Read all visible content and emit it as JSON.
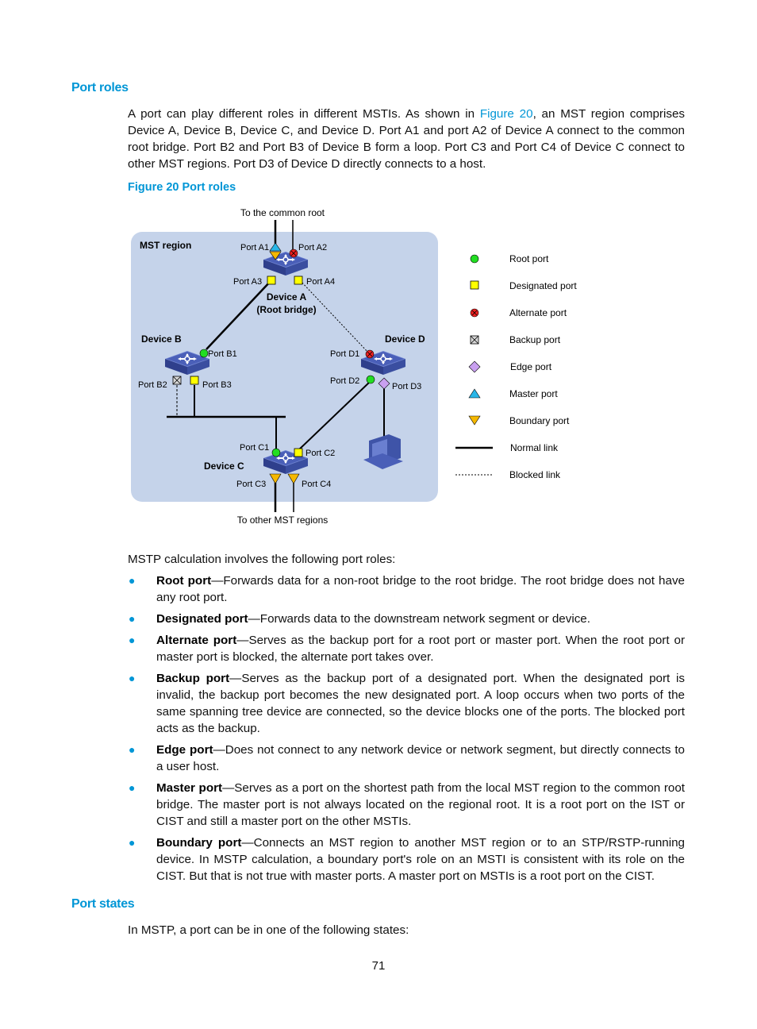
{
  "sections": {
    "port_roles": {
      "heading": "Port roles",
      "intro_before_link": "A port can play different roles in different MSTIs. As shown in ",
      "intro_link": "Figure 20",
      "intro_after_link": ", an MST region comprises Device A, Device B, Device C, and Device D. Port A1 and port A2 of Device A connect to the common root bridge. Port B2 and Port B3 of Device B form a loop. Port C3 and Port C4 of Device C connect to other MST regions. Port D3 of Device D directly connects to a host.",
      "figure_caption": "Figure 20 Port roles",
      "list_intro": "MSTP calculation involves the following port roles:",
      "roles": [
        {
          "term": "Root port",
          "desc": "—Forwards data for a non-root bridge to the root bridge. The root bridge does not have any root port."
        },
        {
          "term": "Designated port",
          "desc": "—Forwards data to the downstream network segment or device."
        },
        {
          "term": "Alternate port",
          "desc": "—Serves as the backup port for a root port or master port. When the root port or master port is blocked, the alternate port takes over."
        },
        {
          "term": "Backup port",
          "desc": "—Serves as the backup port of a designated port. When the designated port is invalid, the backup port becomes the new designated port. A loop occurs when two ports of the same spanning tree device are connected, so the device blocks one of the ports. The blocked port acts as the backup."
        },
        {
          "term": "Edge port",
          "desc": "—Does not connect to any network device or network segment, but directly connects to a user host."
        },
        {
          "term": "Master port",
          "desc": "—Serves as a port on the shortest path from the local MST region to the common root bridge. The master port is not always located on the regional root. It is a root port on the IST or CIST and still a master port on the other MSTIs."
        },
        {
          "term": "Boundary port",
          "desc": "—Connects an MST region to another MST region or to an STP/RSTP-running device. In MSTP calculation, a boundary port's role on an MSTI is consistent with its role on the CIST. But that is not true with master ports. A master port on MSTIs is a root port on the CIST."
        }
      ]
    },
    "port_states": {
      "heading": "Port states",
      "intro": "In MSTP, a port can be in one of the following states:"
    }
  },
  "diagram": {
    "top_label": "To the common root",
    "bottom_label": "To other MST regions",
    "region_label": "MST region",
    "devices": {
      "a_name": "Device A",
      "a_sub": "(Root bridge)",
      "b_name": "Device B",
      "c_name": "Device C",
      "d_name": "Device D"
    },
    "ports": {
      "a1": "Port A1",
      "a2": "Port A2",
      "a3": "Port A3",
      "a4": "Port A4",
      "b1": "Port B1",
      "b2": "Port B2",
      "b3": "Port B3",
      "c1": "Port C1",
      "c2": "Port C2",
      "c3": "Port C3",
      "c4": "Port C4",
      "d1": "Port D1",
      "d2": "Port D2",
      "d3": "Port D3"
    },
    "legend": [
      {
        "symbol": "root-port-icon",
        "label": "Root port"
      },
      {
        "symbol": "designated-port-icon",
        "label": "Designated port"
      },
      {
        "symbol": "alternate-port-icon",
        "label": "Alternate port"
      },
      {
        "symbol": "backup-port-icon",
        "label": "Backup port"
      },
      {
        "symbol": "edge-port-icon",
        "label": "Edge port"
      },
      {
        "symbol": "master-port-icon",
        "label": "Master port"
      },
      {
        "symbol": "boundary-port-icon",
        "label": "Boundary port"
      },
      {
        "symbol": "normal-link-icon",
        "label": "Normal link"
      },
      {
        "symbol": "blocked-link-icon",
        "label": "Blocked link"
      }
    ],
    "colors": {
      "region_fill": "#c5d3ea",
      "switch": "#3f54a8",
      "root": "#22dd22",
      "designated": "#ffff00",
      "alternate": "#ee2020",
      "backup": "#d8d8d8",
      "edge": "#c9a0f0",
      "master": "#29b6e8",
      "boundary": "#f5b800"
    }
  },
  "page_number": "71",
  "theme": {
    "accent": "#0096d6"
  }
}
